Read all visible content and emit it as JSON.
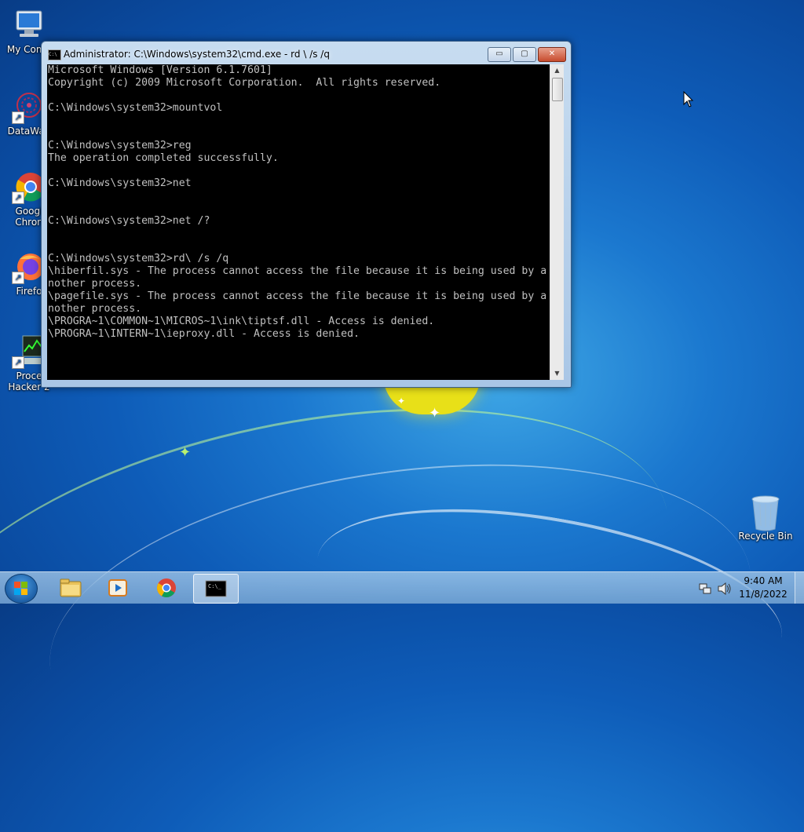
{
  "desktop": {
    "icons": [
      {
        "label": "My Comp",
        "icon": "computer-icon"
      },
      {
        "label": "DataWag",
        "icon": "datawagon-icon"
      },
      {
        "label": "Googl\nChron",
        "icon": "chrome-icon"
      },
      {
        "label": "Firefo",
        "icon": "firefox-icon"
      },
      {
        "label": "Proce\nHacker 2",
        "icon": "process-hacker-icon"
      },
      {
        "label": "Recycle Bin",
        "icon": "recycle-bin-icon"
      }
    ]
  },
  "window": {
    "title": "Administrator: C:\\Windows\\system32\\cmd.exe - rd \\ /s /q",
    "minimize_label": "▭",
    "maximize_label": "▢",
    "close_label": "✕",
    "console_lines": [
      "Microsoft Windows [Version 6.1.7601]",
      "Copyright (c) 2009 Microsoft Corporation.  All rights reserved.",
      "",
      "C:\\Windows\\system32>mountvol",
      "",
      "",
      "C:\\Windows\\system32>reg",
      "The operation completed successfully.",
      "",
      "C:\\Windows\\system32>net",
      "",
      "",
      "C:\\Windows\\system32>net /?",
      "",
      "",
      "C:\\Windows\\system32>rd\\ /s /q",
      "\\hiberfil.sys - The process cannot access the file because it is being used by a",
      "nother process.",
      "\\pagefile.sys - The process cannot access the file because it is being used by a",
      "nother process.",
      "\\PROGRA~1\\COMMON~1\\MICROS~1\\ink\\tiptsf.dll - Access is denied.",
      "\\PROGRA~1\\INTERN~1\\ieproxy.dll - Access is denied."
    ]
  },
  "taskbar": {
    "items": [
      {
        "name": "explorer",
        "icon": "folder-icon"
      },
      {
        "name": "media-player",
        "icon": "media-player-icon"
      },
      {
        "name": "chrome",
        "icon": "chrome-icon"
      },
      {
        "name": "cmd",
        "icon": "cmd-icon",
        "active": true
      }
    ],
    "clock_time": "9:40 AM",
    "clock_date": "11/8/2022"
  }
}
